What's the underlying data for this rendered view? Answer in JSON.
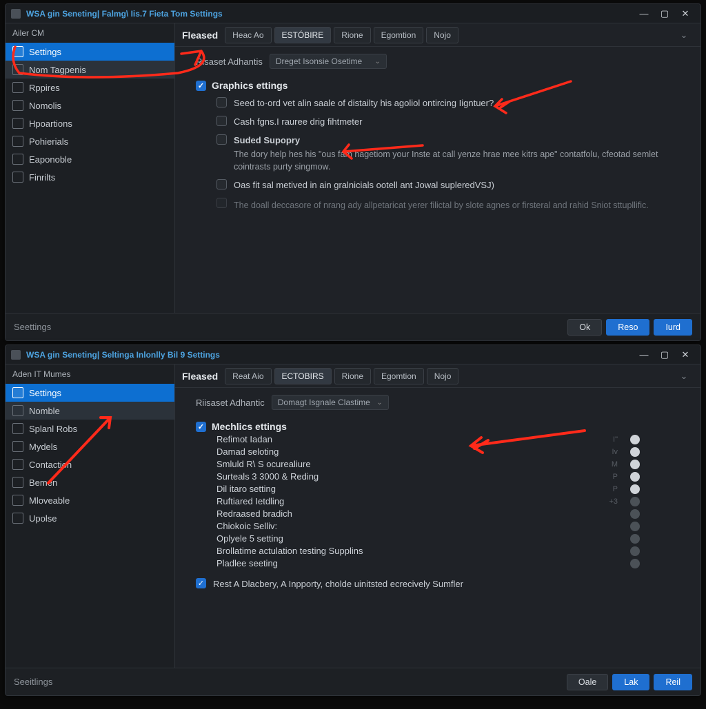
{
  "annotations": {
    "color": "#ff2a1a"
  },
  "top": {
    "title": "WSA gin Seneting| Falmg\\ Iis.7 Fieta Tom Settings",
    "sidebar_header": "Ailer CM",
    "sidebar": {
      "items": [
        {
          "icon": "gear-icon",
          "label": "Settings",
          "selected": true
        },
        {
          "icon": "grid-icon",
          "label": "Nom Tagpenis",
          "sub": true
        },
        {
          "icon": "list-icon",
          "label": "Rppires"
        },
        {
          "icon": "list-icon",
          "label": "Nomolis"
        },
        {
          "icon": "list-icon",
          "label": "Hpoartions"
        },
        {
          "icon": "list-icon",
          "label": "Pohierials"
        },
        {
          "icon": "list-icon",
          "label": "Eaponoble"
        },
        {
          "icon": "list-icon",
          "label": "Finrilts"
        }
      ]
    },
    "tabs_head": "Fleased",
    "tabs": [
      {
        "label": "Heac Ao"
      },
      {
        "label": "ESTÓBIRE",
        "active": true
      },
      {
        "label": "Rione"
      },
      {
        "label": "Egomtion"
      },
      {
        "label": "Nojo"
      }
    ],
    "combo_label": "Risaset Adhantis",
    "combo_value": "Dreget Isonsie Osetime",
    "section_title": "Graphics ettings",
    "options": [
      {
        "checked": false,
        "text": "Seed to·ord vet alin saale of distailty his agoliol ontircing Iigntuer?"
      },
      {
        "checked": false,
        "text": "Cash fgns.I rauree drig fihtmeter"
      },
      {
        "checked": false,
        "bold": true,
        "text": "Suded Supopry",
        "desc": "The dory help hes his \"ous fam hagetiom your Inste at call yenze hrae mee kitrs ape\" contatfolu, cfeotad semlet cointrasts purty singmow."
      },
      {
        "checked": false,
        "text": "Oas fit sal metived in ain gralnicials ootell ant Jowal supleredVSJ)"
      },
      {
        "checked": false,
        "disabled": true,
        "desc_only": "The doall deccasore of nrang ady allpetaricat yerer filictal by slote agnes or firsteral and rahid Sniot sttupllific."
      }
    ],
    "footer_label": "Seettings",
    "footer_buttons": [
      {
        "label": "Ok",
        "primary": false
      },
      {
        "label": "Reso",
        "primary": true
      },
      {
        "label": "Iurd",
        "primary": true
      }
    ]
  },
  "bottom": {
    "title": "WSA gin Seneting| Seltinga Inlonlly Bil 9 Settings",
    "sidebar_header": "Aden IT Mumes",
    "sidebar": {
      "items": [
        {
          "icon": "gear-icon",
          "label": "Settings",
          "selected": true
        },
        {
          "icon": "grid-icon",
          "label": "Nomble",
          "sub": true
        },
        {
          "icon": "star-icon",
          "label": "Splanl Robs"
        },
        {
          "icon": "list-icon",
          "label": "Mydels"
        },
        {
          "icon": "list-icon",
          "label": "Contaction"
        },
        {
          "icon": "list-icon",
          "label": "Bemen"
        },
        {
          "icon": "list-icon",
          "label": "Mloveable"
        },
        {
          "icon": "list-icon",
          "label": "Upolse"
        }
      ]
    },
    "tabs_head": "Fleased",
    "tabs": [
      {
        "label": "Reat Aio"
      },
      {
        "label": "ECTOBIRS",
        "active": true
      },
      {
        "label": "Rione"
      },
      {
        "label": "Egomtion"
      },
      {
        "label": "Nojo"
      }
    ],
    "combo_label": "Riisaset Adhantic",
    "combo_value": "Domagt Isgnale Clastime",
    "section_title": "Mechlics ettings",
    "toggles": [
      {
        "label": "Refimot Iadan",
        "meta": "I\""
      },
      {
        "label": "Damad seloting",
        "meta": "Iv"
      },
      {
        "label": "Smluld R\\ S ocurealiure",
        "meta": "M"
      },
      {
        "label": "Surteals 3 3000 & Reding",
        "meta": "P"
      },
      {
        "label": "Dil itaro setting",
        "meta": "P"
      },
      {
        "label": "Ruftiared Ietdling",
        "meta": "+3",
        "off": true
      },
      {
        "label": "Redraased bradich",
        "off": true
      },
      {
        "label": "Chiokoic Selliv:",
        "off": true
      },
      {
        "label": "Oplyele 5 setting",
        "off": true
      },
      {
        "label": "Brollatime actulation testing Supplins",
        "off": true
      },
      {
        "label": "Pladlee seeting",
        "off": true
      }
    ],
    "bottom_check": "Rest A Dlacbery, A Inpporty, cholde uinitsted ecrecively Sumfler",
    "footer_label": "Seeitlings",
    "footer_buttons": [
      {
        "label": "Oale",
        "primary": false
      },
      {
        "label": "Lak",
        "primary": true
      },
      {
        "label": "Reil",
        "primary": true
      }
    ]
  }
}
